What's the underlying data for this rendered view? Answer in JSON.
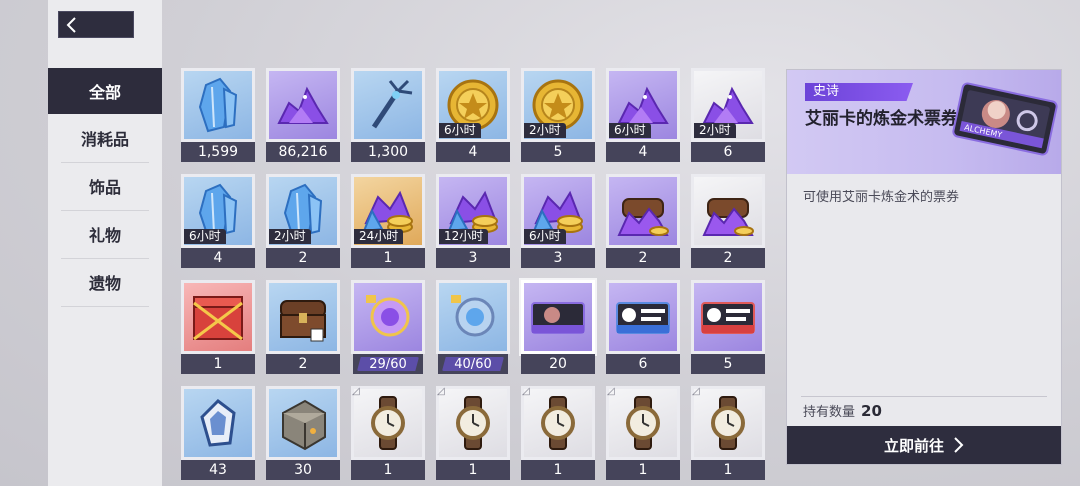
{
  "nav": {
    "back_icon": "chevron-left-icon"
  },
  "categories": [
    {
      "label": "全部",
      "active": true
    },
    {
      "label": "消耗品"
    },
    {
      "label": "饰品"
    },
    {
      "label": "礼物"
    },
    {
      "label": "遗物"
    }
  ],
  "items": [
    {
      "icon": "blue-crystal-icon",
      "count": "1,599"
    },
    {
      "icon": "purple-crystal-pile-icon",
      "count": "86,216"
    },
    {
      "icon": "key-icon",
      "count": "1,300"
    },
    {
      "icon": "gold-coin-icon",
      "count": "4",
      "tag": "6小时"
    },
    {
      "icon": "gold-coin-icon",
      "count": "5",
      "tag": "2小时"
    },
    {
      "icon": "purple-crystal-pile-icon",
      "count": "4",
      "tag": "6小时"
    },
    {
      "icon": "purple-crystal-pile-icon",
      "count": "6",
      "tag": "2小时"
    },
    {
      "icon": "blue-crystal-icon",
      "count": "4",
      "tag": "6小时"
    },
    {
      "icon": "blue-crystal-icon",
      "count": "2",
      "tag": "2小时"
    },
    {
      "icon": "crystal-coin-pile-icon",
      "count": "1",
      "tag": "24小时"
    },
    {
      "icon": "crystal-coin-pile-icon",
      "count": "3",
      "tag": "12小时"
    },
    {
      "icon": "crystal-coin-pile-icon",
      "count": "3",
      "tag": "6小时"
    },
    {
      "icon": "treasure-chest-crystal-icon",
      "count": "2"
    },
    {
      "icon": "treasure-chest-crystal-icon",
      "count": "2"
    },
    {
      "icon": "red-gift-chest-icon",
      "count": "1"
    },
    {
      "icon": "wooden-chest-icon",
      "count": "2"
    },
    {
      "icon": "purple-orb-fragment-icon",
      "progress": "29/60"
    },
    {
      "icon": "blue-orb-fragment-icon",
      "progress": "40/60"
    },
    {
      "icon": "alchemy-ticket-icon",
      "count": "20"
    },
    {
      "icon": "soul-ticket-icon",
      "count": "6"
    },
    {
      "icon": "relic-ticket-icon",
      "count": "5"
    },
    {
      "icon": "blue-gem-icon",
      "count": "43"
    },
    {
      "icon": "stone-cube-icon",
      "count": "30"
    },
    {
      "icon": "wristwatch-icon",
      "count": "1"
    },
    {
      "icon": "wristwatch-icon",
      "count": "1"
    },
    {
      "icon": "wristwatch-icon",
      "count": "1"
    },
    {
      "icon": "wristwatch-icon",
      "count": "1"
    },
    {
      "icon": "wristwatch-icon",
      "count": "1"
    }
  ],
  "detail": {
    "rarity": "史诗",
    "title": "艾丽卡的炼金术票券",
    "description": "可使用艾丽卡炼金术的票券",
    "hold_label": "持有数量",
    "hold_value": "20",
    "go_label": "立即前往",
    "ticket_text": "ALCHEMY"
  },
  "colors": {
    "accent": "#2e2d3e",
    "rarity_purple": "#7a4fe3"
  }
}
